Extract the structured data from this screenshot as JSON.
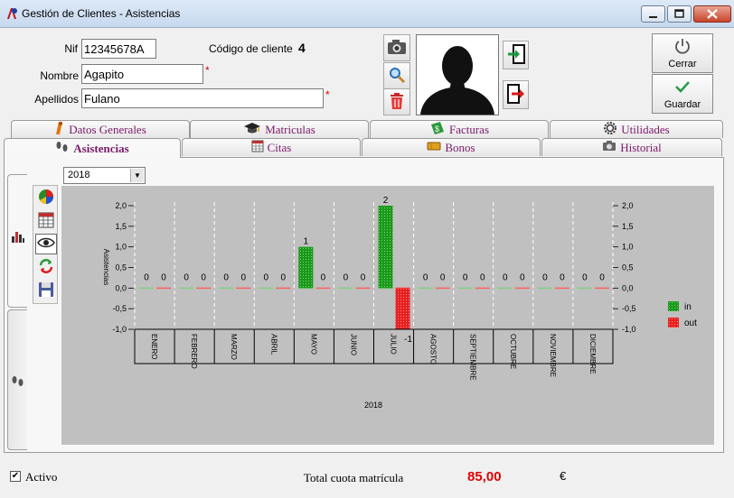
{
  "window": {
    "title": "Gestión de Clientes - Asistencias",
    "min_glyph": "—",
    "max_glyph": "□",
    "close_glyph": "✕"
  },
  "header": {
    "nif_label": "Nif",
    "nif_value": "12345678A",
    "codigo_label": "Código de cliente",
    "codigo_value": "4",
    "nombre_label": "Nombre",
    "nombre_value": "Agapito",
    "apellidos_label": "Apellidos",
    "apellidos_value": "Fulano",
    "required_mark": "*",
    "icons": [
      "camera-icon",
      "search-icon",
      "trash-icon",
      "login-icon",
      "logout-icon"
    ]
  },
  "actions": {
    "close_label": "Cerrar",
    "save_label": "Guardar"
  },
  "tabs_top": [
    {
      "label": "Datos Generales",
      "icon": "info-icon"
    },
    {
      "label": "Matriculas",
      "icon": "graduation-cap-icon"
    },
    {
      "label": "Facturas",
      "icon": "invoice-icon"
    },
    {
      "label": "Utilidades",
      "icon": "gear-icon"
    }
  ],
  "tabs_bottom": [
    {
      "label": "Asistencias",
      "icon": "footprints-icon",
      "active": true
    },
    {
      "label": "Citas",
      "icon": "calendar-icon"
    },
    {
      "label": "Bonos",
      "icon": "ticket-icon"
    },
    {
      "label": "Historial",
      "icon": "camera-icon"
    }
  ],
  "year_select": {
    "value": "2018"
  },
  "chart_data": {
    "type": "bar",
    "categories": [
      "ENERO",
      "FEBRERO",
      "MARZO",
      "ABRIL",
      "MAYO",
      "JUNIO",
      "JULIO",
      "AGOSTO",
      "SEPTIEMBRE",
      "OCTUBRE",
      "NOVIEMBRE",
      "DICIEMBRE"
    ],
    "category_labels_shown": [
      "ENERO",
      "FEBRERO",
      "MARZO",
      "ABRIL",
      "MAYO",
      "JUNIO",
      "JULIO",
      "AGOSTO",
      "SEPTIEMBRE",
      "OCTUBRE",
      "NOVIEMBRE",
      "DICIEMBRE"
    ],
    "series": [
      {
        "name": "in",
        "color": "#1a9a1a",
        "values": [
          0,
          0,
          0,
          0,
          1,
          0,
          2,
          0,
          0,
          0,
          0,
          0
        ]
      },
      {
        "name": "out",
        "color": "#e82020",
        "values": [
          0,
          0,
          0,
          0,
          0,
          0,
          -1,
          0,
          0,
          0,
          0,
          0
        ]
      }
    ],
    "data_labels_in": [
      "0",
      "0",
      "0",
      "0",
      "1",
      "0",
      "2",
      "0",
      "0",
      "0",
      "0",
      "0"
    ],
    "data_labels_out": [
      "0",
      "0",
      "0",
      "0",
      "0",
      "0",
      "-1",
      "0",
      "0",
      "0",
      "0",
      "0"
    ],
    "ylabel": "Asistencias",
    "xlabel": "2018",
    "ylim": [
      -1.0,
      2.0
    ],
    "yticks": [
      "2,0",
      "1,5",
      "1,0",
      "0,5",
      "0,0",
      "-0,5",
      "-1,0"
    ],
    "legend_position": "right",
    "grid": "vertical-dashed"
  },
  "footer": {
    "activo_label": "Activo",
    "activo_checked": "✔",
    "total_label": "Total cuota matrícula",
    "total_value": "85,00",
    "currency": "€"
  }
}
